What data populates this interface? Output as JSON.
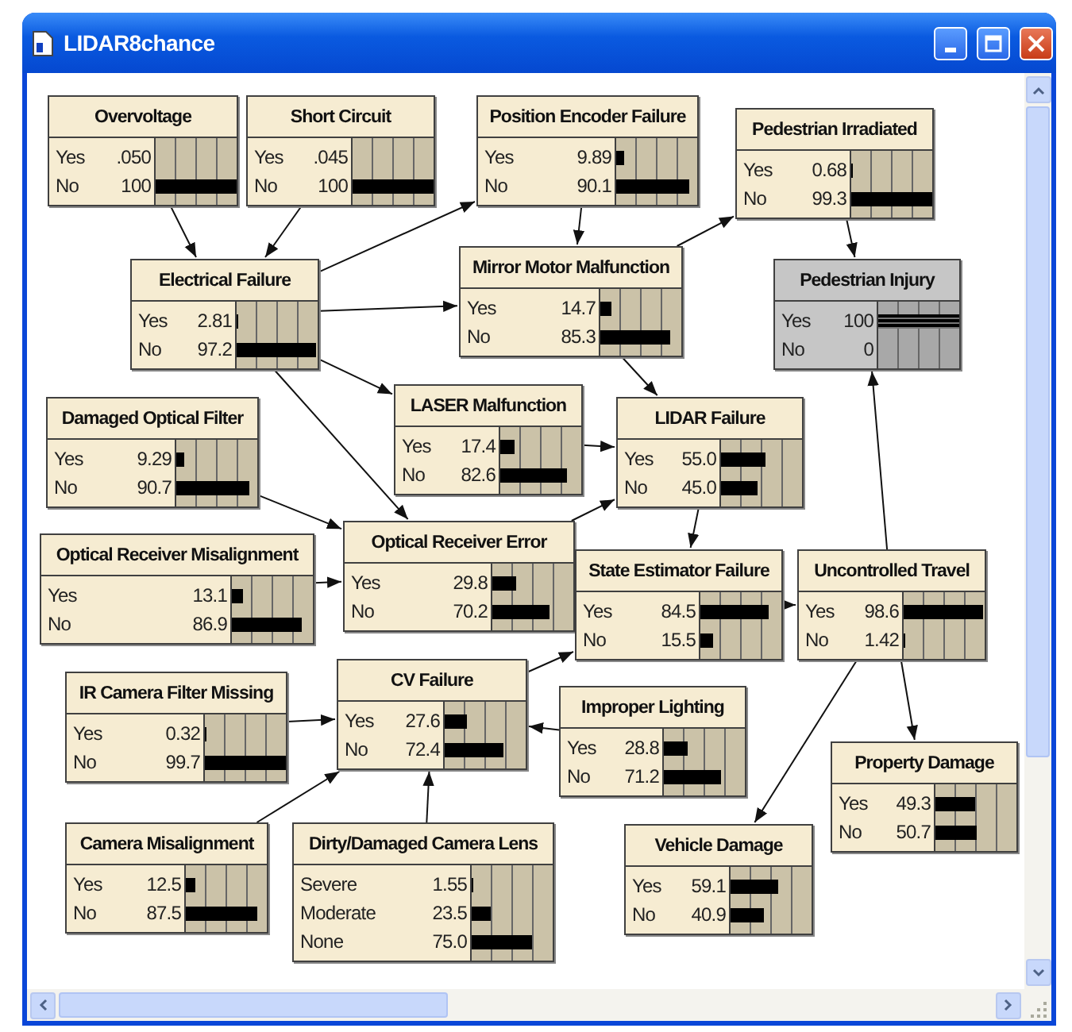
{
  "window": {
    "title": "LIDAR8chance"
  },
  "nodes": [
    {
      "title": "Overvoltage",
      "observed": false,
      "states": [
        {
          "label": "Yes",
          "value": ".050",
          "level": 0.0005
        },
        {
          "label": "No",
          "value": "100",
          "level": 1
        }
      ]
    },
    {
      "title": "Short Circuit",
      "observed": false,
      "states": [
        {
          "label": "Yes",
          "value": ".045",
          "level": 0.00045
        },
        {
          "label": "No",
          "value": "100",
          "level": 1
        }
      ]
    },
    {
      "title": "Position Encoder Failure",
      "observed": false,
      "states": [
        {
          "label": "Yes",
          "value": "9.89",
          "level": 0.0989
        },
        {
          "label": "No",
          "value": "90.1",
          "level": 0.901
        }
      ]
    },
    {
      "title": "Pedestrian Irradiated",
      "observed": false,
      "states": [
        {
          "label": "Yes",
          "value": "0.68",
          "level": 0.0068
        },
        {
          "label": "No",
          "value": "99.3",
          "level": 0.993
        }
      ]
    },
    {
      "title": "Electrical Failure",
      "observed": false,
      "states": [
        {
          "label": "Yes",
          "value": "2.81",
          "level": 0.0281
        },
        {
          "label": "No",
          "value": "97.2",
          "level": 0.972
        }
      ]
    },
    {
      "title": "Mirror Motor Malfunction",
      "observed": false,
      "states": [
        {
          "label": "Yes",
          "value": "14.7",
          "level": 0.147
        },
        {
          "label": "No",
          "value": "85.3",
          "level": 0.853
        }
      ]
    },
    {
      "title": "Pedestrian Injury",
      "observed": true,
      "states": [
        {
          "label": "Yes",
          "value": "100",
          "level": 1
        },
        {
          "label": "No",
          "value": "0",
          "level": 0
        }
      ]
    },
    {
      "title": "Damaged Optical Filter",
      "observed": false,
      "states": [
        {
          "label": "Yes",
          "value": "9.29",
          "level": 0.0929
        },
        {
          "label": "No",
          "value": "90.7",
          "level": 0.907
        }
      ]
    },
    {
      "title": "LASER Malfunction",
      "observed": false,
      "states": [
        {
          "label": "Yes",
          "value": "17.4",
          "level": 0.174
        },
        {
          "label": "No",
          "value": "82.6",
          "level": 0.826
        }
      ]
    },
    {
      "title": "LIDAR Failure",
      "observed": false,
      "states": [
        {
          "label": "Yes",
          "value": "55.0",
          "level": 0.55
        },
        {
          "label": "No",
          "value": "45.0",
          "level": 0.45
        }
      ]
    },
    {
      "title": "Optical Receiver Misalignment",
      "observed": false,
      "states": [
        {
          "label": "Yes",
          "value": "13.1",
          "level": 0.131
        },
        {
          "label": "No",
          "value": "86.9",
          "level": 0.869
        }
      ]
    },
    {
      "title": "Optical Receiver Error",
      "observed": false,
      "states": [
        {
          "label": "Yes",
          "value": "29.8",
          "level": 0.298
        },
        {
          "label": "No",
          "value": "70.2",
          "level": 0.702
        }
      ]
    },
    {
      "title": "State Estimator Failure",
      "observed": false,
      "states": [
        {
          "label": "Yes",
          "value": "84.5",
          "level": 0.845
        },
        {
          "label": "No",
          "value": "15.5",
          "level": 0.155
        }
      ]
    },
    {
      "title": "Uncontrolled Travel",
      "observed": false,
      "states": [
        {
          "label": "Yes",
          "value": "98.6",
          "level": 0.986
        },
        {
          "label": "No",
          "value": "1.42",
          "level": 0.0142
        }
      ]
    },
    {
      "title": "IR Camera Filter Missing",
      "observed": false,
      "states": [
        {
          "label": "Yes",
          "value": "0.32",
          "level": 0.0032
        },
        {
          "label": "No",
          "value": "99.7",
          "level": 0.997
        }
      ]
    },
    {
      "title": "CV Failure",
      "observed": false,
      "states": [
        {
          "label": "Yes",
          "value": "27.6",
          "level": 0.276
        },
        {
          "label": "No",
          "value": "72.4",
          "level": 0.724
        }
      ]
    },
    {
      "title": "Improper Lighting",
      "observed": false,
      "states": [
        {
          "label": "Yes",
          "value": "28.8",
          "level": 0.288
        },
        {
          "label": "No",
          "value": "71.2",
          "level": 0.712
        }
      ]
    },
    {
      "title": "Camera Misalignment",
      "observed": false,
      "states": [
        {
          "label": "Yes",
          "value": "12.5",
          "level": 0.125
        },
        {
          "label": "No",
          "value": "87.5",
          "level": 0.875
        }
      ]
    },
    {
      "title": "Dirty/Damaged Camera Lens",
      "observed": false,
      "states": [
        {
          "label": "Severe",
          "value": "1.55",
          "level": 0.0155
        },
        {
          "label": "Moderate",
          "value": "23.5",
          "level": 0.235
        },
        {
          "label": "None",
          "value": "75.0",
          "level": 0.75
        }
      ]
    },
    {
      "title": "Vehicle Damage",
      "observed": false,
      "states": [
        {
          "label": "Yes",
          "value": "59.1",
          "level": 0.591
        },
        {
          "label": "No",
          "value": "40.9",
          "level": 0.409
        }
      ]
    },
    {
      "title": "Property Damage",
      "observed": false,
      "states": [
        {
          "label": "Yes",
          "value": "49.3",
          "level": 0.493
        },
        {
          "label": "No",
          "value": "50.7",
          "level": 0.507
        }
      ]
    }
  ]
}
